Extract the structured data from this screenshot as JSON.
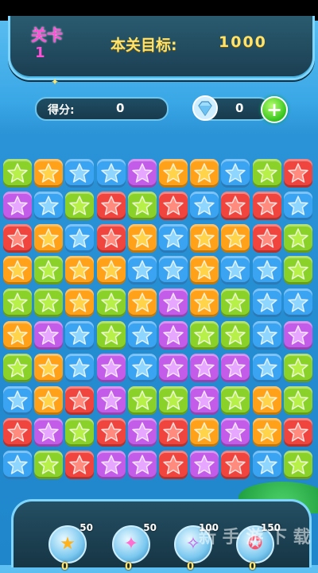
{
  "header": {
    "level_label": "关卡",
    "level_number": "1",
    "target_label": "本关目标:",
    "target_value": "1000"
  },
  "status": {
    "score_label": "得分:",
    "score_value": "0",
    "gems_value": "0",
    "add_symbol": "+"
  },
  "board": {
    "colors": {
      "G": "#8ad22a",
      "O": "#ffa21a",
      "B": "#3aa3f2",
      "P": "#c35ce8",
      "R": "#f0443f"
    },
    "star_colors": {
      "G": "#b8f04a",
      "O": "#ffd44a",
      "B": "#8fd6ff",
      "P": "#e7a6ff",
      "R": "#ff8a7e"
    },
    "rows": [
      [
        "G",
        "O",
        "B",
        "B",
        "P",
        "O",
        "O",
        "B",
        "G",
        "R"
      ],
      [
        "P",
        "B",
        "G",
        "R",
        "G",
        "R",
        "B",
        "R",
        "R",
        "B"
      ],
      [
        "R",
        "O",
        "B",
        "R",
        "O",
        "B",
        "O",
        "O",
        "R",
        "G"
      ],
      [
        "O",
        "G",
        "O",
        "O",
        "B",
        "B",
        "O",
        "B",
        "B",
        "G"
      ],
      [
        "G",
        "G",
        "O",
        "G",
        "O",
        "P",
        "O",
        "G",
        "B",
        "B"
      ],
      [
        "O",
        "P",
        "B",
        "G",
        "B",
        "P",
        "G",
        "G",
        "B",
        "P"
      ],
      [
        "G",
        "O",
        "B",
        "P",
        "B",
        "P",
        "P",
        "P",
        "B",
        "G"
      ],
      [
        "B",
        "O",
        "R",
        "P",
        "G",
        "G",
        "P",
        "G",
        "O",
        "G"
      ],
      [
        "R",
        "P",
        "G",
        "R",
        "P",
        "R",
        "O",
        "P",
        "O",
        "R"
      ],
      [
        "B",
        "G",
        "R",
        "P",
        "P",
        "R",
        "P",
        "R",
        "B",
        "G"
      ]
    ]
  },
  "tools": [
    {
      "cost": "50",
      "count": "0",
      "icon": "bomb-star-icon",
      "glyph": "★"
    },
    {
      "cost": "50",
      "count": "0",
      "icon": "magic-wand-icon",
      "glyph": "✦"
    },
    {
      "cost": "100",
      "count": "0",
      "icon": "rainbow-brush-icon",
      "glyph": "✧"
    },
    {
      "cost": "150",
      "count": "0",
      "icon": "colorful-stars-icon",
      "glyph": "✪"
    }
  ],
  "watermark": "新 手 游 下 载"
}
